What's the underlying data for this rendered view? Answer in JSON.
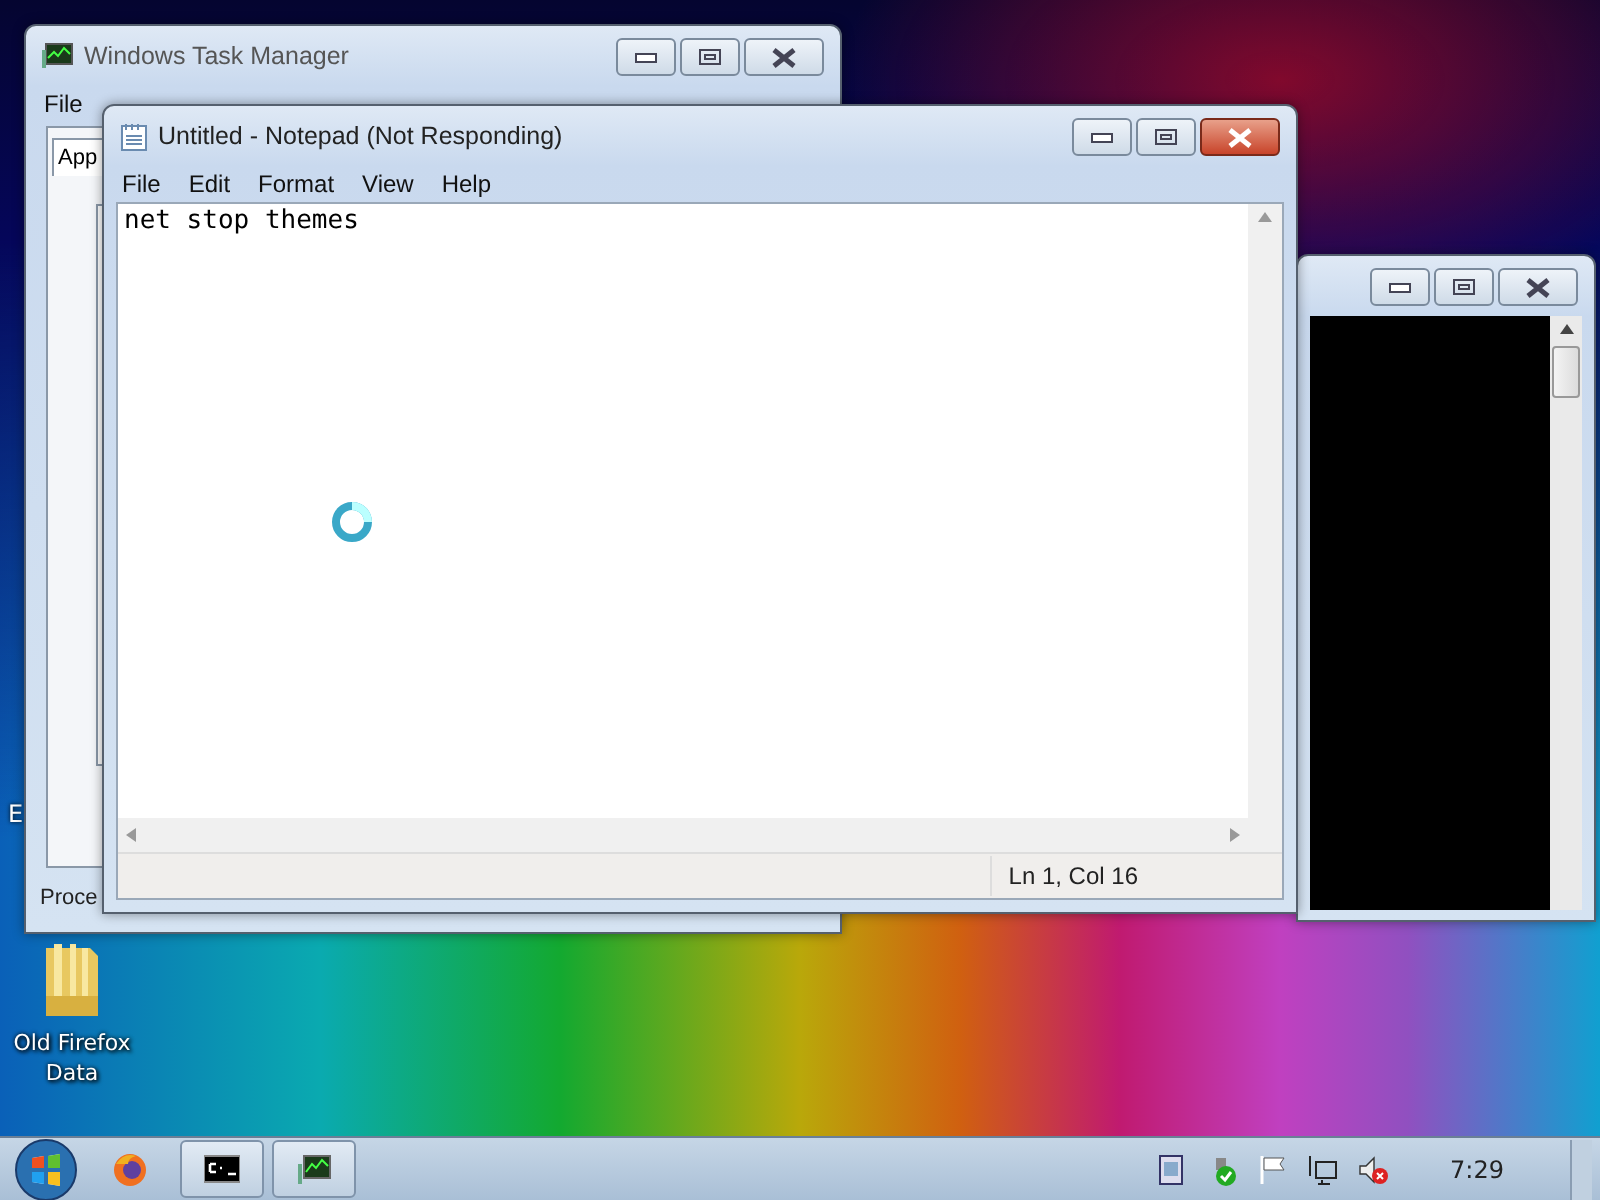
{
  "desktop": {
    "icons": [
      {
        "label": "Old Firefox Data"
      }
    ],
    "fragments": [
      "E"
    ]
  },
  "windows": [
    {
      "kind": "taskmgr",
      "title": "Windows Task Manager",
      "active": false,
      "menu": [
        "File"
      ],
      "tab": "App",
      "status": "Proce"
    },
    {
      "kind": "console",
      "active": false
    },
    {
      "kind": "notepad",
      "title": "Untitled - Notepad (Not Responding)",
      "active": true,
      "menu": [
        "File",
        "Edit",
        "Format",
        "View",
        "Help"
      ],
      "text": "net stop themes",
      "status": "Ln 1, Col 16",
      "busy": true
    }
  ],
  "taskbar": {
    "pinned": [
      {
        "kind": "firefox",
        "open": false
      },
      {
        "kind": "cmd",
        "open": true
      },
      {
        "kind": "taskmgr",
        "open": true
      }
    ],
    "clock": "7:29"
  }
}
